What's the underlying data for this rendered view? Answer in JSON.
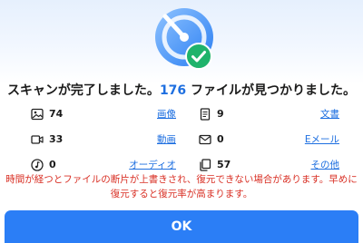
{
  "dialog": {
    "headline_prefix": "スキャンが完了しました。",
    "found_count": "176",
    "headline_suffix": " ファイルが見つかりました。"
  },
  "categories": [
    {
      "count": "74",
      "label": "画像",
      "icon": "image-icon"
    },
    {
      "count": "9",
      "label": "文書",
      "icon": "document-icon"
    },
    {
      "count": "33",
      "label": "動画",
      "icon": "video-icon"
    },
    {
      "count": "0",
      "label": "Eメール",
      "icon": "email-icon"
    },
    {
      "count": "0",
      "label": "オーディオ",
      "icon": "music-icon"
    },
    {
      "count": "57",
      "label": "その他",
      "icon": "other-files-icon"
    }
  ],
  "warning": {
    "line1": "時間が経つとファイルの断片が上書きされ、復元できない場合があります。早めに",
    "line2": "復元すると復元率が高まります。"
  },
  "ok_label": "OK",
  "colors": {
    "accent": "#2b7ef6",
    "link": "#1e6fe0",
    "warning": "#d93025",
    "success": "#1fb36b"
  }
}
